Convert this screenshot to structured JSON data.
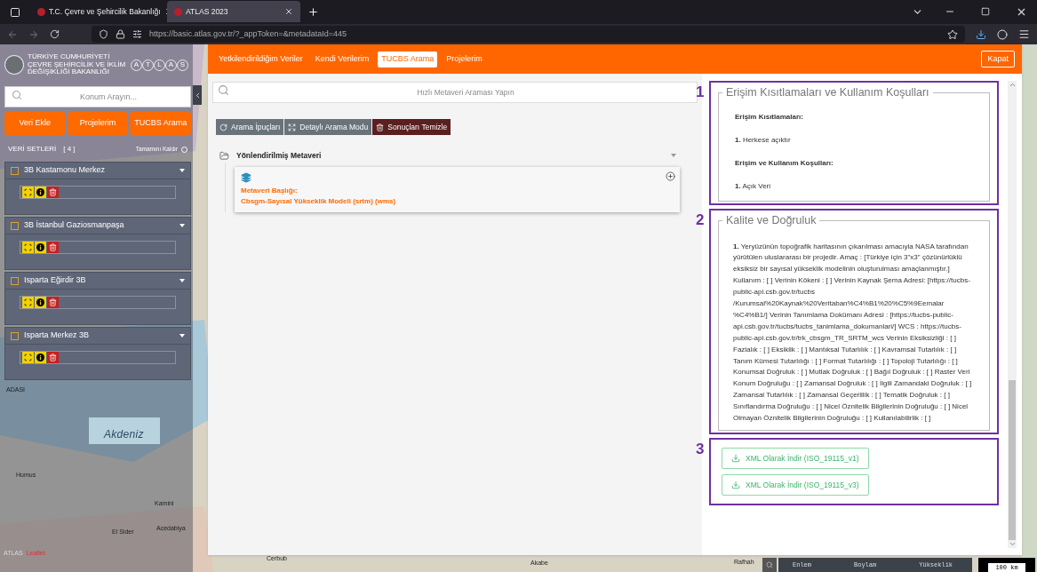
{
  "browser": {
    "tabs": [
      {
        "label": "T.C. Çevre ve Şehircilik Bakanlığı",
        "selected": false
      },
      {
        "label": "ATLAS 2023",
        "selected": true
      }
    ],
    "url": "https://basic.atlas.gov.tr/?_appToken=&metadataId=445"
  },
  "sidebar": {
    "logo": {
      "ministry": "TÜRKİYE CUMHURİYETİ ÇEVRE ŞEHİRCİLİK VE İKLİM DEĞİŞİKLİĞİ BAKANLIĞI",
      "letters": [
        "A",
        "T",
        "L",
        "A",
        "S"
      ]
    },
    "search": {
      "placeholder": "Konum Arayın..."
    },
    "buttons": [
      "Veri Ekle",
      "Projelerim",
      "TUCBS Arama"
    ],
    "datasets_label": "VERİ SETLERİ",
    "datasets_count": "[ 4 ]",
    "remove_all": "Tamamını Kaldır",
    "datasets": [
      {
        "name": "3B Kastamonu Merkez",
        "checked": false
      },
      {
        "name": "3B İstanbul Gaziosmanpaşa",
        "checked": false
      },
      {
        "name": "Isparta Eğirdir 3B",
        "checked": false
      },
      {
        "name": "Isparta Merkez 3B",
        "checked": false
      }
    ]
  },
  "map": {
    "labels": [
      {
        "text": "Akdeniz",
        "kind": "sea"
      },
      {
        "text": "ADASI",
        "kind": "place"
      },
      {
        "text": "Humus",
        "kind": "place"
      },
      {
        "text": "Kamini",
        "kind": "place"
      },
      {
        "text": "El Sider",
        "kind": "place"
      },
      {
        "text": "Acedabiya",
        "kind": "place"
      },
      {
        "text": "Cerbub",
        "kind": "place"
      },
      {
        "text": "Akabe",
        "kind": "place"
      },
      {
        "text": "Rafhah",
        "kind": "place"
      }
    ],
    "attribution": "ATLAS",
    "attribution_link": "Leaflet",
    "status": {
      "lat": "Enlem",
      "lon": "Boylam",
      "elev": "Yükseklik",
      "scale": "100 km"
    }
  },
  "modal": {
    "tabs": [
      {
        "label": "Yetkilendirildiğim Veriler",
        "selected": false
      },
      {
        "label": "Kendi Verilerim",
        "selected": false
      },
      {
        "label": "TUCBS Arama",
        "selected": true
      },
      {
        "label": "Projelerim",
        "selected": false
      }
    ],
    "close": "Kapat",
    "search": {
      "placeholder": "Hızlı Metaveri Araması Yapın"
    },
    "tools": [
      {
        "label": "Arama İpuçları",
        "kind": "hint"
      },
      {
        "label": "Detaylı Arama Modu",
        "kind": "expand"
      },
      {
        "label": "Sonuçları Temizle",
        "kind": "clear"
      }
    ],
    "tree": [
      {
        "label": "Yönlendirilmiş Metaveri",
        "expanded": true,
        "children": [
          {
            "title_label": "Metaveri Başlığı:",
            "title": "Cbsgm-Sayısal Yükseklik Modeli (srtm) (wms)"
          }
        ]
      }
    ],
    "detail": {
      "sections": [
        {
          "number": "1",
          "kind": "fields",
          "legend": "Erişim Kısıtlamaları ve Kullanım Koşulları",
          "items": [
            {
              "heading": "Erişim Kısıtlamaları:",
              "text": "**1.** Herkese açıktır"
            },
            {
              "heading": "Erişim ve Kullanım Koşulları:",
              "text": "**1.** Açık Veri"
            }
          ]
        },
        {
          "number": "2",
          "kind": "paragraph",
          "legend": "Kalite ve Doğruluk",
          "text": "**1.** Yeryüzünün topoğrafik haritasının çıkarılması amacıyla NASA tarafından yürütülen uluslararası bir projedir. Amaç : [Türkiye için 3\"x3\" çözünürlüklü eksiksiz bir sayısal yükseklik modelinin oluşturulması amaçlanmıştır.] Kullanım : [ ] Verinin Kökeni : [ ] Verinin Kaynak Şema Adresi: [https://tucbs-public-api.csb.gov.tr/tucbs /Kurumsal%20Kaynak%20Veritaban%C4%B1%20%C5%9Eemalar %C4%B1/] Verinin Tanımlama Dokümanı Adresi : [https://tucbs-public-api.csb.gov.tr/tucbs/tucbs_tanimlama_dokumanlari/] WCS : https://tucbs-public-api.csb.gov.tr/trk_cbsgm_TR_SRTM_wcs Verinin Eksiksizliği : [ ] Fazlalık : [ ] Eksiklik : [ ] Mantıksal Tutarlılık : [ ] Kavramsal Tutarlılık : [ ] Tanım Kümesi Tutarlılığı : [ ] Format Tutarlılığı : [ ] Topoloji Tutarlılığı : [ ] Konumsal Doğruluk : [ ] Mutlak Doğruluk : [ ] Bağıl Doğruluk : [ ] Raster Veri Konum Doğruluğu : [ ] Zamansal Doğruluk : [ ] İlgili Zamandaki Doğruluk : [ ] Zamansal Tutarlılık : [ ] Zamansal Geçerlilik : [ ] Tematik Doğruluk : [ ] Sınıflandırma Doğruluğu : [ ] Nicel Öznitelik Bilgilerinin Doğruluğu : [ ] Nicel Olmayan Öznitelik Bilgilerinin Doğruluğu : [ ] Kullanılabilirlik : [ ]"
        },
        {
          "number": "3",
          "kind": "downloads",
          "buttons": [
            "XML Olarak İndir (ISO_19115_v1)",
            "XML Olarak İndir (ISO_19115_v3)"
          ]
        }
      ]
    }
  }
}
